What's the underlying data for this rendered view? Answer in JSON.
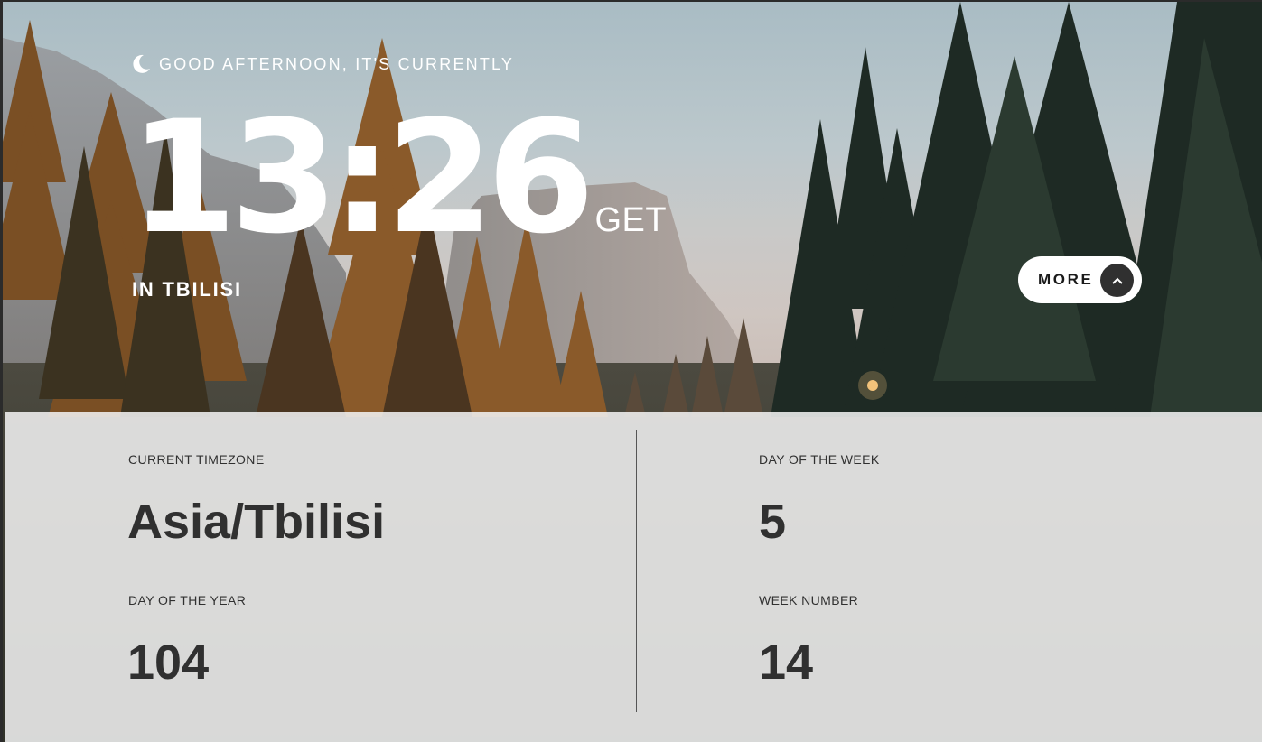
{
  "hero": {
    "greeting": "GOOD AFTERNOON, IT'S CURRENTLY",
    "greeting_icon": "moon-icon",
    "time": "13:26",
    "timezone_abbr": "GET",
    "location": "IN TBILISI",
    "more_label": "MORE",
    "more_icon": "chevron-up-icon"
  },
  "details": {
    "current_timezone": {
      "label": "CURRENT TIMEZONE",
      "value": "Asia/Tbilisi"
    },
    "day_of_year": {
      "label": "DAY OF THE YEAR",
      "value": "104"
    },
    "day_of_week": {
      "label": "DAY OF THE WEEK",
      "value": "5"
    },
    "week_number": {
      "label": "WEEK NUMBER",
      "value": "14"
    }
  },
  "colors": {
    "hero_text": "#ffffff",
    "panel_background": "#f0f0f0",
    "panel_text": "#303030",
    "button_circle": "#303030"
  }
}
